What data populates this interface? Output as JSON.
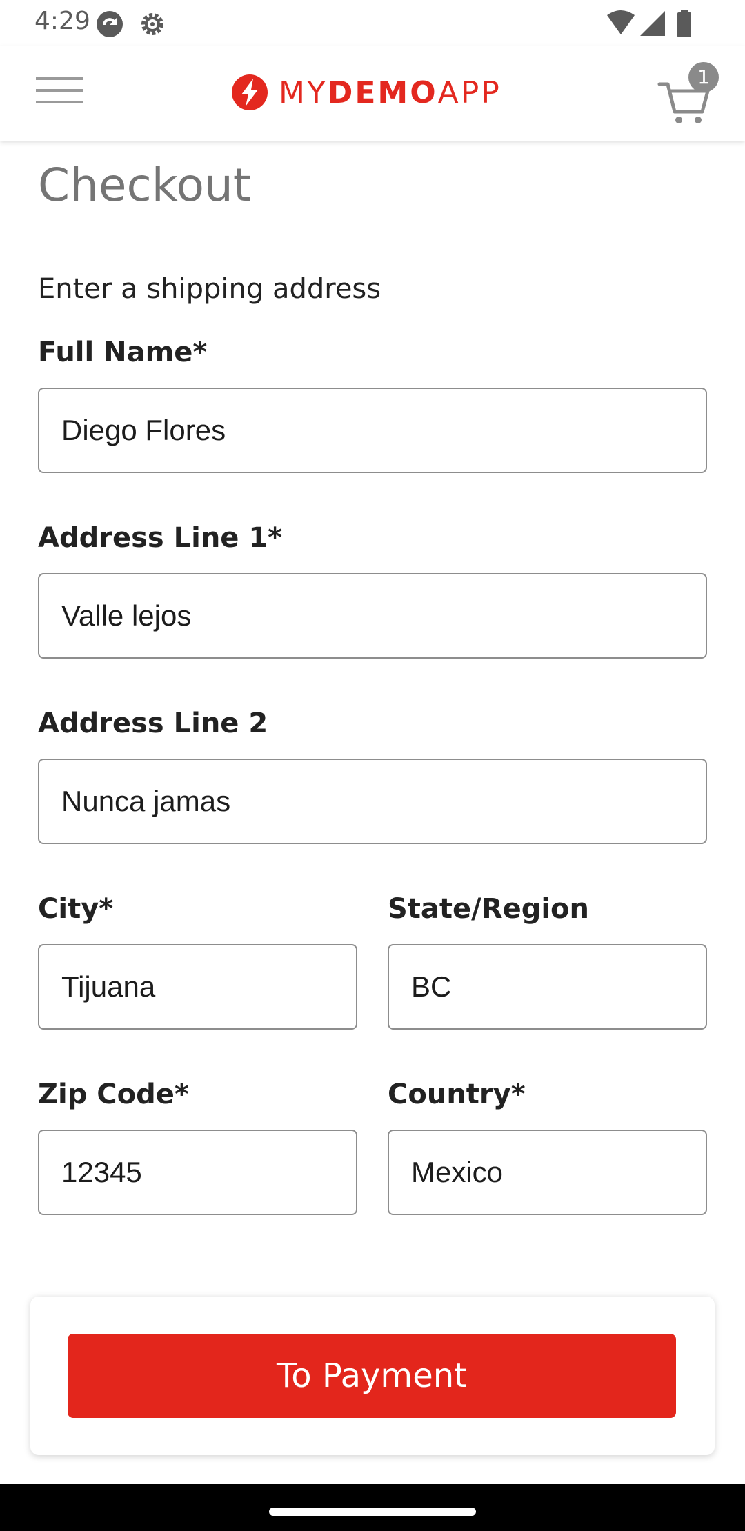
{
  "status_bar": {
    "time": "4:29",
    "icons": [
      "sync-icon",
      "settings-icon",
      "wifi-icon",
      "cell-signal-icon",
      "battery-icon"
    ]
  },
  "header": {
    "logo": {
      "light1": "MY",
      "bold": "DEMO",
      "light2": "APP"
    },
    "cart_count": "1",
    "brand_color": "#e3281f"
  },
  "page": {
    "title": "Checkout",
    "section_heading": "Enter a shipping address"
  },
  "form": {
    "full_name": {
      "label": "Full Name*",
      "value": "Diego Flores"
    },
    "address1": {
      "label": "Address Line 1*",
      "value": "Valle lejos"
    },
    "address2": {
      "label": "Address Line 2",
      "value": "Nunca jamas"
    },
    "city": {
      "label": "City*",
      "value": "Tijuana"
    },
    "state": {
      "label": "State/Region",
      "value": "BC"
    },
    "zip": {
      "label": "Zip Code*",
      "value": "12345"
    },
    "country": {
      "label": "Country*",
      "value": "Mexico"
    }
  },
  "footer": {
    "button_label": "To Payment",
    "button_color": "#e3261c"
  }
}
